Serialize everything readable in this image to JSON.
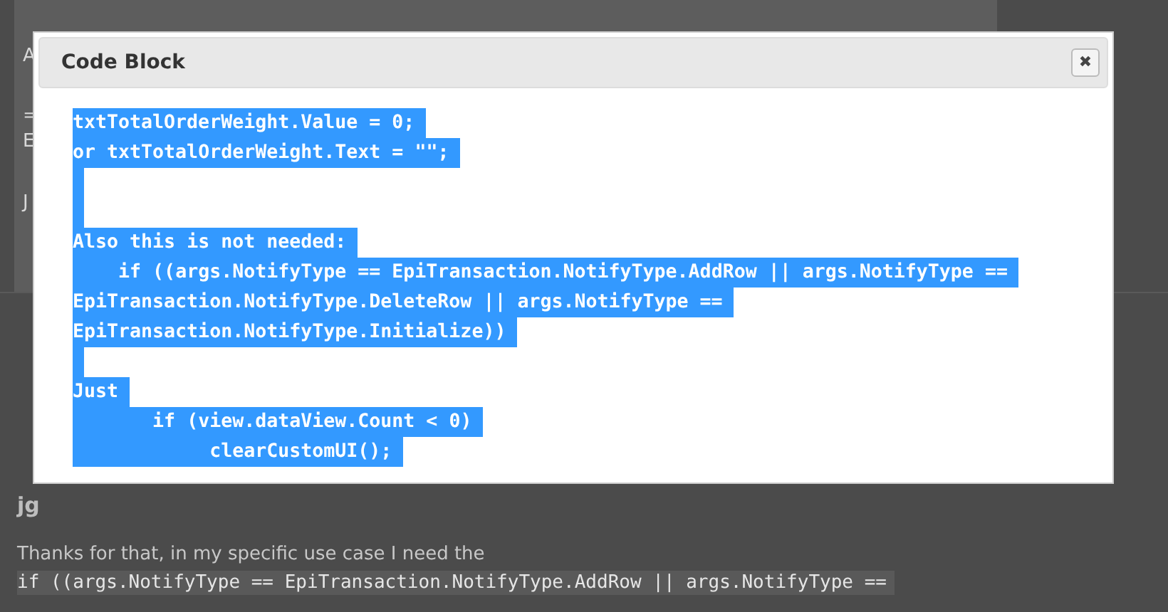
{
  "background": {
    "fragments": [
      "A",
      "=",
      "E",
      "J"
    ],
    "author": "jg",
    "reply_text": "Thanks for that, in my specific use case I need the",
    "reply_code": "if ((args.NotifyType == EpiTransaction.NotifyType.AddRow || args.NotifyType =="
  },
  "dialog": {
    "title": "Code Block",
    "close_label": "✖",
    "lines": [
      {
        "kind": "code",
        "text": "txtTotalOrderWeight.Value = 0;",
        "selected": true
      },
      {
        "kind": "code",
        "text": "**or** txtTotalOrderWeight.**Text** = \"\";",
        "selected": true
      },
      {
        "kind": "blank",
        "selected": true
      },
      {
        "kind": "blank",
        "selected": true
      },
      {
        "kind": "code",
        "text": "Also this **is not** needed:",
        "selected": true
      },
      {
        "kind": "code",
        "text": "    **if** ((args.NotifyType == EpiTransaction.NotifyType.AddRow || args.NotifyType ==",
        "selected": true
      },
      {
        "kind": "code",
        "text": "EpiTransaction.NotifyType.DeleteRow || args.NotifyType ==",
        "selected": true
      },
      {
        "kind": "code",
        "text": "EpiTransaction.NotifyType.Initialize))",
        "selected": true
      },
      {
        "kind": "blank",
        "selected": true
      },
      {
        "kind": "code",
        "text": "Just",
        "selected": true
      },
      {
        "kind": "code",
        "text": "       **if** (view.dataView.Count < 0)",
        "selected": true
      },
      {
        "kind": "code",
        "text": "            clearCustomUI();",
        "selected": true
      }
    ]
  }
}
